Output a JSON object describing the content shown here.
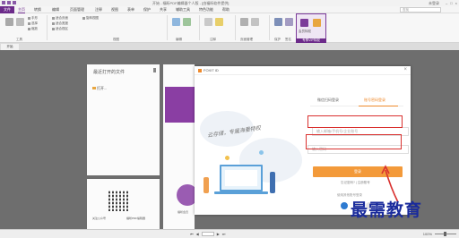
{
  "titlebar": {
    "title": "开始 - 福昕PDF编辑器个人版 - [由福昕软件提供]",
    "user": "未登录"
  },
  "menu": {
    "file": "文件",
    "items": [
      "主页",
      "转换",
      "编辑",
      "页面管理",
      "注释",
      "视图",
      "表单",
      "保护",
      "共享",
      "辅助工具",
      "特色功能",
      "帮助"
    ],
    "search_placeholder": "查找"
  },
  "ribbon": {
    "groups": [
      {
        "name": "工具",
        "items": [
          "手形",
          "选择",
          "缩放"
        ]
      },
      {
        "name": "视图",
        "items": [
          "适合页面",
          "适合宽度",
          "适合视区",
          "旋转视图"
        ]
      },
      {
        "name": "编辑",
        "items": [
          "编辑文本",
          "编辑对象"
        ]
      },
      {
        "name": "注释",
        "items": [
          "打字机",
          "高亮"
        ]
      },
      {
        "name": "页面管理",
        "items": [
          "插入",
          "删除"
        ]
      },
      {
        "name": "保护",
        "items": [
          "保护"
        ]
      },
      {
        "name": "签名",
        "items": [
          "签名"
        ]
      },
      {
        "name": "专属特权",
        "items": [
          "会员特权"
        ]
      }
    ],
    "highlight_group": "专享VIP特权"
  },
  "doctab": {
    "label": "开始"
  },
  "recent": {
    "header": "最近打开的文件",
    "open_label": "打开..."
  },
  "qr_card": {
    "label_left": "关注公众号",
    "label_right": "福昕PDF编辑器"
  },
  "purple_card": {
    "label": "福昕会员"
  },
  "dialog": {
    "title": "FOXIT ID",
    "close": "×",
    "slogan": "云存储，专属海量特权",
    "tabs": [
      "微信扫码登录",
      "账号密码登录"
    ],
    "account_placeholder": "输入邮箱/手机号/企业账号",
    "password_placeholder": "输入密码",
    "login_button": "登录",
    "sub_links": "忘记密码?  |  注册账号",
    "other_login": "使用其他账号登录"
  },
  "watermark": "最需教育",
  "statusbar": {
    "zoom": "100%"
  },
  "colors": {
    "brand_purple": "#6c2b8a",
    "accent_orange": "#f39a3a",
    "highlight_red": "#d9302e",
    "watermark_blue": "#1a2b9c"
  }
}
